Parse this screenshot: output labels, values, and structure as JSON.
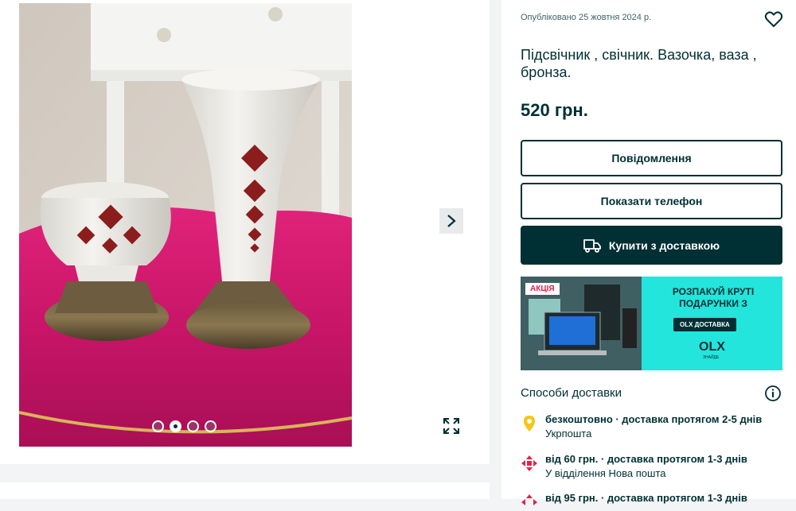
{
  "gallery": {
    "current_index": 2,
    "total": 4
  },
  "listing": {
    "published": "Опубліковано 25 жовтня 2024 р.",
    "title": "Підсвічник , свічник. Вазочка, ваза , бронза.",
    "price": "520 грн."
  },
  "actions": {
    "message_label": "Повідомлення",
    "phone_label": "Показати телефон",
    "buy_label": "Купити з доставкою"
  },
  "banner": {
    "badge": "АКЦІЯ",
    "headline_line1": "РОЗПАКУЙ КРУТІ",
    "headline_line2": "ПОДАРУНКИ З",
    "button": "OLX ДОСТАВКА",
    "logo": "OLX",
    "logo_sub": "ЗНАЙДЕ"
  },
  "delivery": {
    "heading": "Способи доставки",
    "items": [
      {
        "line1": "безкоштовно · доставка протягом 2-5 днів",
        "line2": "Укрпошта",
        "icon": "ukrposhta-icon",
        "color": "#f5c518"
      },
      {
        "line1": "від 60 грн. · доставка протягом 1-3 днів",
        "line2": "У відділення Нова пошта",
        "icon": "nova-poshta-icon",
        "color": "#e0234a"
      },
      {
        "line1": "від 95 грн. · доставка протягом 1-3 днів",
        "line2": "",
        "icon": "nova-poshta-icon",
        "color": "#e0234a"
      }
    ]
  },
  "colors": {
    "primary": "#002f34",
    "accent": "#23e5db",
    "background": "#f2f4f5"
  }
}
